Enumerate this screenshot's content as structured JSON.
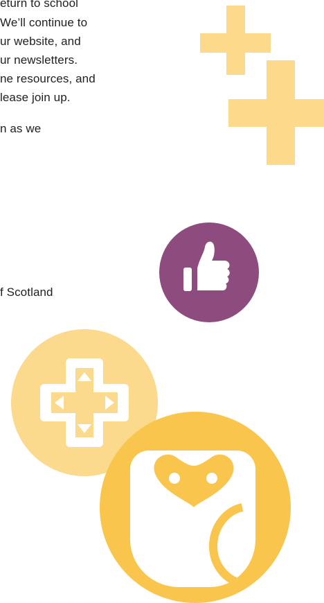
{
  "paragraph_lines": [
    "eturn to school",
    "We’ll continue to",
    "ur website, and",
    "ur newsletters.",
    "ne resources, and",
    "lease join up."
  ],
  "fragment_line": "n as we",
  "footer_fragment": "f Scotland",
  "icons": {
    "plus_top": "plus-icon",
    "plus_bottom": "plus-icon",
    "thumbs_up": "thumbs-up-icon",
    "gamepad": "gamepad-dpad-icon",
    "owl": "owl-icon"
  },
  "colors": {
    "text": "#1f1f1f",
    "light_yellow": "#fdd98c",
    "purple": "#8e4b7e",
    "mid_yellow": "#fbd98d",
    "gold": "#f9c54d"
  }
}
